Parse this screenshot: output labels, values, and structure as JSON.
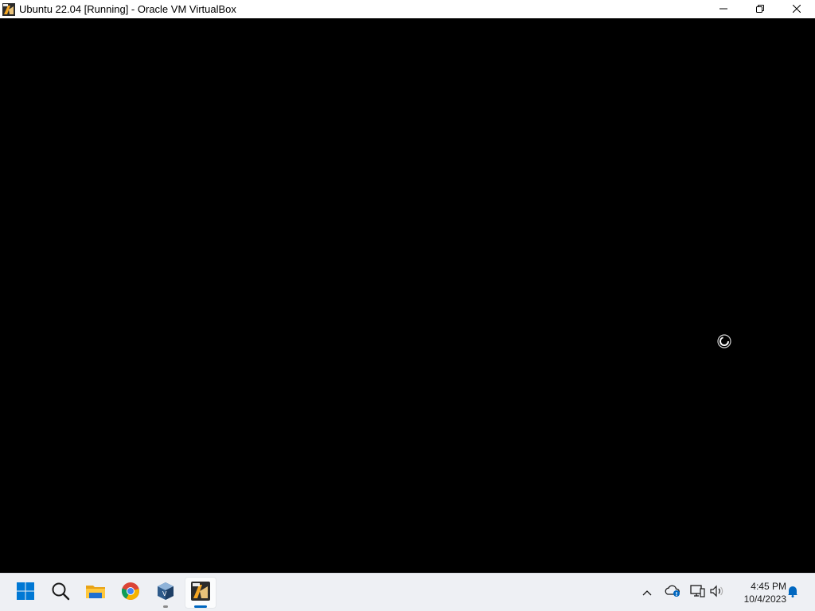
{
  "window": {
    "title": "Ubuntu 22.04 [Running] - Oracle VM VirtualBox",
    "controls": {
      "minimize": "minimize-icon",
      "maximize": "restore-icon",
      "close": "close-icon"
    }
  },
  "vm": {
    "background": "#000000",
    "status_indicator": "loading-spinner-icon"
  },
  "taskbar": {
    "background": "#eef0f4",
    "items": [
      {
        "name": "start",
        "icon": "windows-start-icon"
      },
      {
        "name": "search",
        "icon": "search-icon"
      },
      {
        "name": "file-explorer",
        "icon": "folder-icon"
      },
      {
        "name": "chrome",
        "icon": "chrome-icon"
      },
      {
        "name": "virtualbox",
        "icon": "virtualbox-icon"
      },
      {
        "name": "vm-window",
        "icon": "vm-app-icon",
        "active": true
      }
    ],
    "tray": {
      "overflow": "chevron-up-icon",
      "onedrive": "cloud-icon",
      "network": "network-icon",
      "volume": "speaker-icon",
      "notifications": "bell-icon"
    },
    "clock": {
      "time": "4:45 PM",
      "date": "10/4/2023"
    }
  },
  "colors": {
    "accent": "#0067c0",
    "indicator_active": "#0067c0",
    "indicator_inactive": "#8a8a8a"
  }
}
